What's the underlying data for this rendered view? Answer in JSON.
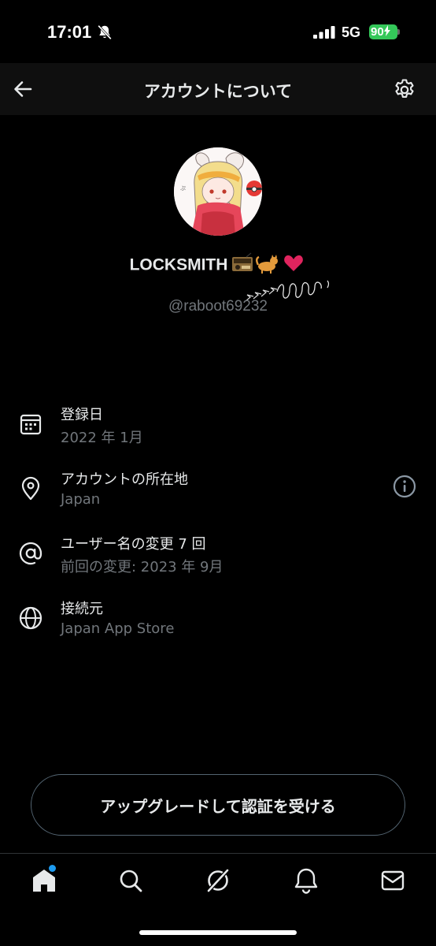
{
  "status_bar": {
    "time": "17:01",
    "network": "5G",
    "battery_level": "90",
    "battery_fraction": 0.9,
    "accent": "#34c759"
  },
  "header": {
    "title": "アカウントについて",
    "back_icon": "arrow-left-icon",
    "settings_icon": "gear-icon"
  },
  "profile": {
    "display_name": "LOCKSMITH",
    "emojis": "📻🐈❤️",
    "handle": "@raboot69232"
  },
  "info": [
    {
      "icon": "calendar-icon",
      "title": "登録日",
      "subtitle": "2022 年 1月"
    },
    {
      "icon": "location-pin-icon",
      "title": "アカウントの所在地",
      "subtitle": "Japan",
      "help_icon": "info-circle-icon"
    },
    {
      "icon": "at-sign-icon",
      "title": "ユーザー名の変更 7 回",
      "subtitle": "前回の変更: 2023 年 9月"
    },
    {
      "icon": "globe-icon",
      "title": "接続元",
      "subtitle": "Japan App Store"
    }
  ],
  "upgrade_button": {
    "label": "アップグレードして認証を受ける"
  },
  "bottom_nav": [
    {
      "icon": "home-icon",
      "active": true,
      "badge": true
    },
    {
      "icon": "search-icon"
    },
    {
      "icon": "grok-icon"
    },
    {
      "icon": "bell-icon"
    },
    {
      "icon": "mail-icon"
    }
  ],
  "colors": {
    "background": "#000000",
    "header_bg": "#0f0f0f",
    "text_primary": "#e7e9ea",
    "text_secondary": "#71767b",
    "accent_blue": "#1d9bf0"
  }
}
